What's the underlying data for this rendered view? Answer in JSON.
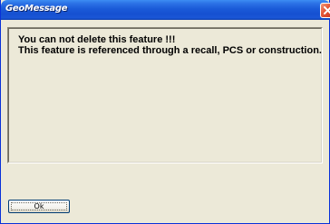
{
  "window": {
    "title": "GeoMessage"
  },
  "message": {
    "line1": "You can not delete this feature !!!",
    "line2": "This feature is referenced through a recall, PCS or construction."
  },
  "buttons": {
    "ok_label": "Ok"
  },
  "colors": {
    "titlebar": "#1650d1",
    "close_button": "#e5593a",
    "dialog_background": "#ece9d8"
  },
  "icons": {
    "close": "close-icon"
  }
}
